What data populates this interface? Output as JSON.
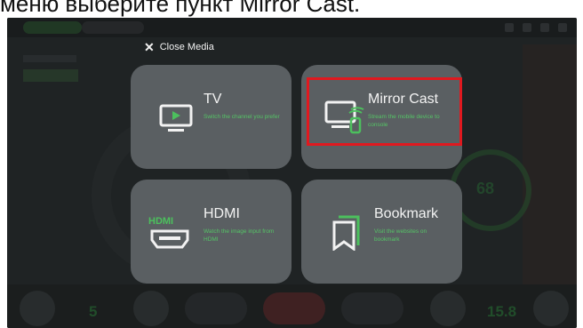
{
  "caption": "меню выберите пункт Mirror Cast.",
  "overlay": {
    "close_label": "Close Media"
  },
  "cards": {
    "tv": {
      "title": "TV",
      "desc": "Switch the channel you prefer",
      "icon": "tv-icon"
    },
    "mirror": {
      "title": "Mirror Cast",
      "desc": "Stream the mobile device to console",
      "icon": "mirror-cast-icon"
    },
    "hdmi": {
      "title": "HDMI",
      "desc": "Watch the image input from HDMI",
      "icon": "hdmi-icon"
    },
    "bookmark": {
      "title": "Bookmark",
      "desc": "Visit the websites on bookmark",
      "icon": "bookmark-icon"
    }
  },
  "background": {
    "right_value": "68",
    "bottom_left_value": "5",
    "bottom_right_value": "15.8"
  },
  "colors": {
    "accent_green": "#55c466",
    "highlight_red": "#e0191f",
    "card_bg": "#5a5f62"
  }
}
